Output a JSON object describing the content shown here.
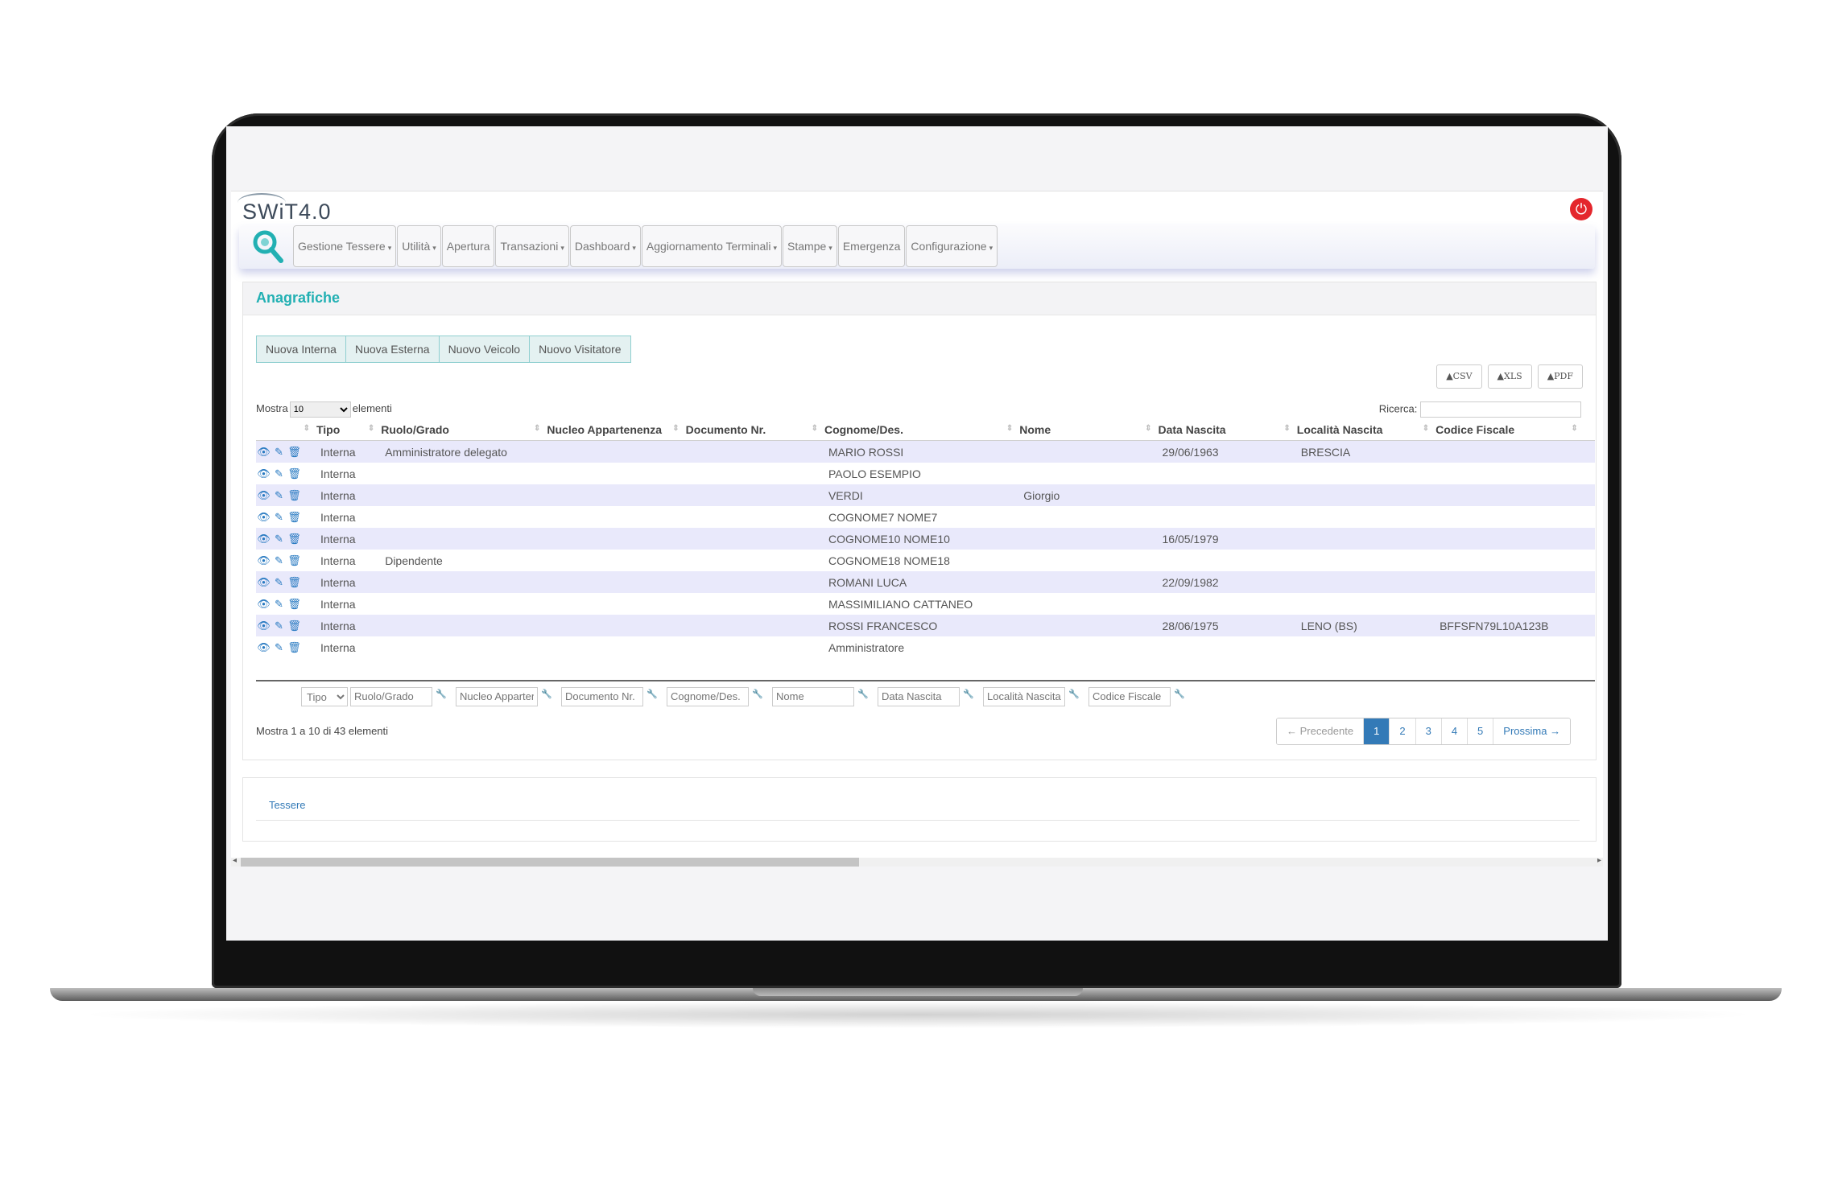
{
  "app": {
    "logo_text": "SWiT4.0",
    "power_icon": "power-icon"
  },
  "nav": {
    "items": [
      {
        "label": "Gestione Tessere",
        "dropdown": true
      },
      {
        "label": "Utilità",
        "dropdown": true
      },
      {
        "label": "Apertura",
        "dropdown": false
      },
      {
        "label": "Transazioni",
        "dropdown": true
      },
      {
        "label": "Dashboard",
        "dropdown": true
      },
      {
        "label": "Aggiornamento Terminali",
        "dropdown": true
      },
      {
        "label": "Stampe",
        "dropdown": true
      },
      {
        "label": "Emergenza",
        "dropdown": false
      },
      {
        "label": "Configurazione",
        "dropdown": true
      }
    ]
  },
  "panel": {
    "title": "Anagrafiche",
    "actions": [
      "Nuova Interna",
      "Nuova Esterna",
      "Nuovo Veicolo",
      "Nuovo Visitatore"
    ],
    "exports": [
      "▲CSV",
      "▲XLS",
      "▲PDF"
    ],
    "length_label_before": "Mostra",
    "length_value": "10",
    "length_label_after": "elementi",
    "search_label": "Ricerca:",
    "columns": [
      "Tipo",
      "Ruolo/Grado",
      "Nucleo Appartenenza",
      "Documento Nr.",
      "Cognome/Des.",
      "Nome",
      "Data Nascita",
      "Località Nascita",
      "Codice Fiscale"
    ],
    "rows": [
      {
        "tipo": "Interna",
        "ruolo": "Amministratore delegato",
        "nucleo": "",
        "documento": "",
        "cognome": "MARIO ROSSI",
        "nome": "",
        "data": "29/06/1963",
        "localita": "BRESCIA",
        "cf": ""
      },
      {
        "tipo": "Interna",
        "ruolo": "",
        "nucleo": "",
        "documento": "",
        "cognome": "PAOLO ESEMPIO",
        "nome": "",
        "data": "",
        "localita": "",
        "cf": ""
      },
      {
        "tipo": "Interna",
        "ruolo": "",
        "nucleo": "",
        "documento": "",
        "cognome": "VERDI",
        "nome": "Giorgio",
        "data": "",
        "localita": "",
        "cf": ""
      },
      {
        "tipo": "Interna",
        "ruolo": "",
        "nucleo": "",
        "documento": "",
        "cognome": "COGNOME7 NOME7",
        "nome": "",
        "data": "",
        "localita": "",
        "cf": ""
      },
      {
        "tipo": "Interna",
        "ruolo": "",
        "nucleo": "",
        "documento": "",
        "cognome": "COGNOME10 NOME10",
        "nome": "",
        "data": "16/05/1979",
        "localita": "",
        "cf": ""
      },
      {
        "tipo": "Interna",
        "ruolo": "Dipendente",
        "nucleo": "",
        "documento": "",
        "cognome": "COGNOME18 NOME18",
        "nome": "",
        "data": "",
        "localita": "",
        "cf": ""
      },
      {
        "tipo": "Interna",
        "ruolo": "",
        "nucleo": "",
        "documento": "",
        "cognome": "ROMANI LUCA",
        "nome": "",
        "data": "22/09/1982",
        "localita": "",
        "cf": ""
      },
      {
        "tipo": "Interna",
        "ruolo": "",
        "nucleo": "",
        "documento": "",
        "cognome": "MASSIMILIANO CATTANEO",
        "nome": "",
        "data": "",
        "localita": "",
        "cf": ""
      },
      {
        "tipo": "Interna",
        "ruolo": "",
        "nucleo": "",
        "documento": "",
        "cognome": "ROSSI FRANCESCO",
        "nome": "",
        "data": "28/06/1975",
        "localita": "LENO (BS)",
        "cf": "BFFSFN79L10A123B"
      },
      {
        "tipo": "Interna",
        "ruolo": "",
        "nucleo": "",
        "documento": "",
        "cognome": "Amministratore",
        "nome": "",
        "data": "",
        "localita": "",
        "cf": ""
      }
    ],
    "filters": {
      "tipo_select": "Tipo",
      "placeholders": [
        "Ruolo/Grado",
        "Nucleo Appartenenza",
        "Documento Nr.",
        "Cognome/Des.",
        "Nome",
        "Data Nascita",
        "Località Nascita",
        "Codice Fiscale"
      ]
    },
    "info": "Mostra 1 a 10 di 43 elementi",
    "pagination": {
      "prev": "← Precedente",
      "pages": [
        "1",
        "2",
        "3",
        "4",
        "5"
      ],
      "active_page": "1",
      "next": "Prossima →"
    }
  },
  "panel2": {
    "link": "Tessere"
  },
  "colors": {
    "accent": "#22b0b3",
    "row_stripe": "#e9e9fb",
    "link": "#337ab7",
    "power": "#e4262c"
  }
}
